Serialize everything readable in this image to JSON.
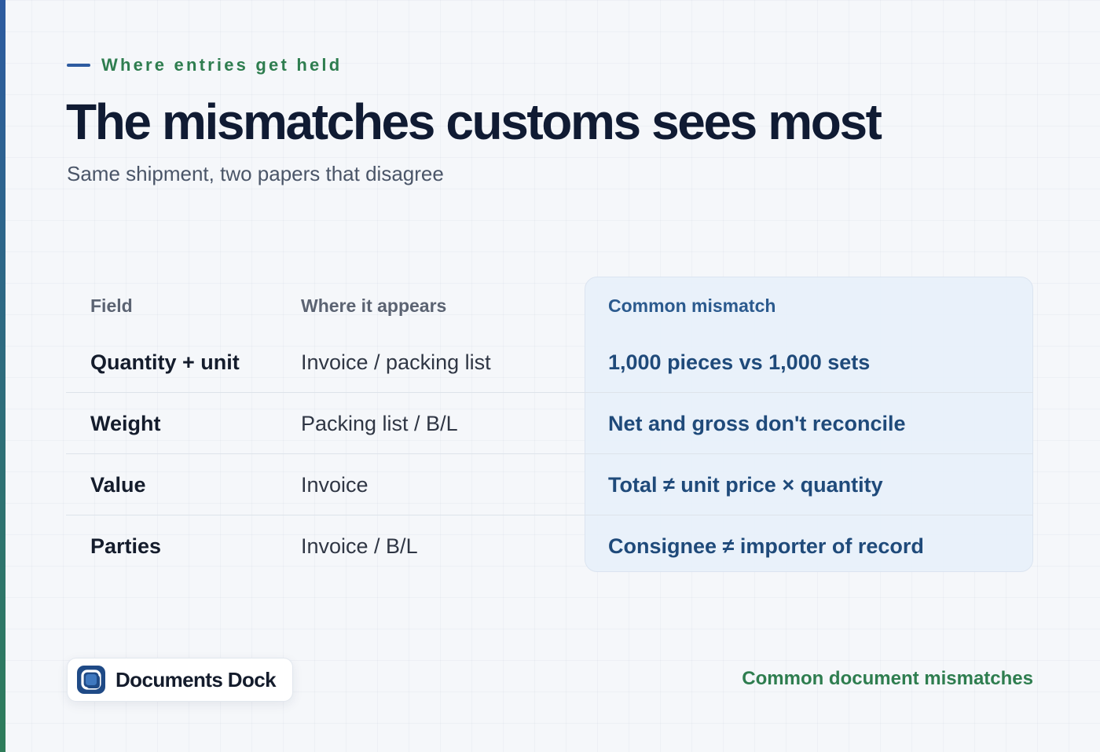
{
  "eyebrow": "Where entries get held",
  "title": "The mismatches customs sees most",
  "subtitle": "Same shipment, two papers that disagree",
  "table": {
    "headers": [
      "Field",
      "Where it appears",
      "Common mismatch"
    ],
    "rows": [
      {
        "field": "Quantity + unit",
        "appears": "Invoice / packing list",
        "mismatch": "1,000 pieces vs 1,000 sets"
      },
      {
        "field": "Weight",
        "appears": "Packing list / B/L",
        "mismatch": "Net and gross don't reconcile"
      },
      {
        "field": "Value",
        "appears": "Invoice",
        "mismatch": "Total ≠ unit price × quantity"
      },
      {
        "field": "Parties",
        "appears": "Invoice / B/L",
        "mismatch": "Consignee ≠ importer of record"
      }
    ]
  },
  "brand": {
    "name": "Documents Dock",
    "logo_icon": "documents-dock-logo-icon"
  },
  "footer_caption": "Common document mismatches",
  "colors": {
    "accent_blue": "#2d5ba0",
    "accent_green": "#2e7d4f",
    "mismatch_text": "#1f4a7a",
    "title_text": "#101b33"
  }
}
